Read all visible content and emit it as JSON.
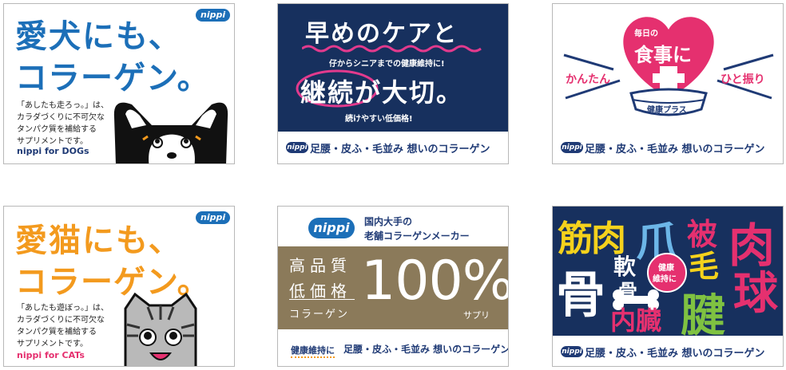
{
  "cards": {
    "dog": {
      "badge": "nippi",
      "headline1": "愛犬にも、",
      "headline2": "コラーゲン。",
      "body": [
        "「あしたも走ろっ。」は、",
        "カラダづくりに不可欠な",
        "タンパク質を補給する",
        "サプリメントです。"
      ],
      "brand": "nippi for DOGs",
      "accent": "#1c6fb8"
    },
    "care": {
      "title": "早めのケアと",
      "subtitle": "仔からシニアまでの健康維持に!",
      "main": "継続が大切。",
      "small": "続けやすい低価格!",
      "bg": "#17305e",
      "wave": "#e23a8d",
      "footer_badge": "nippi",
      "footer": "足腰・皮ふ・毛並み 想いのコラーゲン"
    },
    "meal": {
      "heart_small": "毎日の",
      "heart_big": "食事に",
      "bowl": "健康プラス",
      "left": "かんたん",
      "right": "ひと振り",
      "accent": "#e5306f",
      "footer_badge": "nippi",
      "footer": "足腰・皮ふ・毛並み 想いのコラーゲン"
    },
    "cat": {
      "badge": "nippi",
      "headline1": "愛猫にも、",
      "headline2": "コラーゲン。",
      "body": [
        "「あしたも遊ぼっ。」は、",
        "カラダづくりに不可欠な",
        "タンパク質を補給する",
        "サプリメントです。"
      ],
      "brand": "nippi for CATs",
      "accent": "#f39a1e"
    },
    "maker": {
      "logo": "nippi",
      "line1": "国内大手の",
      "line2": "老舗コラーゲンメーカー",
      "q1": "高品質",
      "q2": "低価格",
      "q3": "コラーゲン",
      "big": "100%",
      "supp": "サプリ",
      "footer_lead": "健康維持に",
      "footer": "足腰・皮ふ・毛並み 想いのコラーゲン",
      "band": "#8b7a5a"
    },
    "body": {
      "words": {
        "kin": "筋肉",
        "tsume": "爪",
        "hi": "被",
        "mo": "毛",
        "niku": "肉",
        "kyu": "球",
        "hone": "骨",
        "nankotsu_a": "軟",
        "nankotsu_b": "骨",
        "naizo": "内臓",
        "ken": "腱",
        "circle": [
          "健康",
          "維持に"
        ]
      },
      "bg": "#17305e",
      "footer_badge": "nippi",
      "footer": "足腰・皮ふ・毛並み 想いのコラーゲン"
    }
  }
}
